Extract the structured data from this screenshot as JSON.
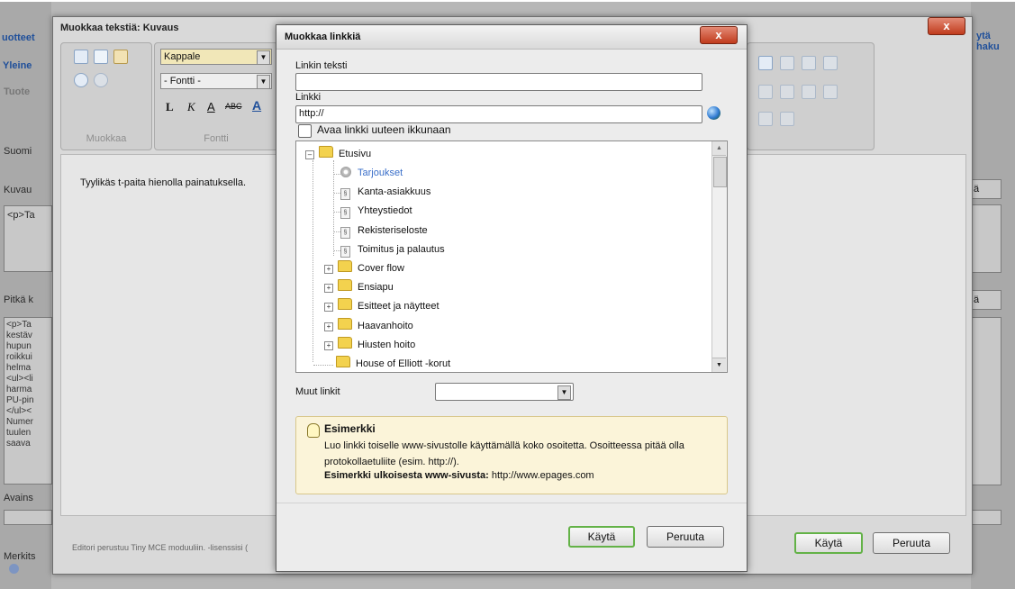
{
  "background": {
    "top_left_link": "uotteet",
    "tab_general": "Yleine",
    "tab_products": "Tuote",
    "lang": "Suomi",
    "kuvaus_label": "Kuvau",
    "kuvaus_text": "<p>Ta",
    "long_desc_label": "Pitkä k",
    "long_desc_lines": [
      "<p>Ta",
      "kestäv",
      "hupun",
      "roikkui",
      "helma",
      "<ul><li",
      "harma",
      "PU-pin",
      "</ul><",
      "Numer",
      "tuulen",
      "saava"
    ],
    "keywords_label": "Avains",
    "marks_label": "Merkits",
    "right_link": "ytä haku",
    "right_btn_1": "ä",
    "right_btn_2": "ä"
  },
  "editor": {
    "title": "Muokkaa tekstiä: Kuvaus",
    "format_select": "Kappale",
    "font_select": "- Fontti -",
    "group_edit_label": "Muokkaa",
    "group_font_label": "Fontti",
    "format_buttons": [
      "L",
      "K",
      "A",
      "ABC",
      "A"
    ],
    "content_text": "Tyylikäs t-paita hienolla painatuksella.",
    "footer_text": "Editori perustuu Tiny MCE moduuliin. -lisenssisi (",
    "apply_label": "Käytä",
    "cancel_label": "Peruuta",
    "close_label": "x"
  },
  "dialog": {
    "title": "Muokkaa linkkiä",
    "close_label": "x",
    "link_text_label": "Linkin teksti",
    "link_text_value": "",
    "link_label": "Linkki",
    "link_value": "http://",
    "new_window_label": "Avaa linkki uuteen ikkunaan",
    "tree": {
      "root": "Etusivu",
      "items": [
        {
          "label": "Tarjoukset",
          "type": "special"
        },
        {
          "label": "Kanta-asiakkuus",
          "type": "page"
        },
        {
          "label": "Yhteystiedot",
          "type": "page"
        },
        {
          "label": "Rekisteriseloste",
          "type": "page"
        },
        {
          "label": "Toimitus ja palautus",
          "type": "page"
        },
        {
          "label": "Cover flow",
          "type": "folder"
        },
        {
          "label": "Ensiapu",
          "type": "folder"
        },
        {
          "label": "Esitteet ja näytteet",
          "type": "folder"
        },
        {
          "label": "Haavanhoito",
          "type": "folder"
        },
        {
          "label": "Hiusten hoito",
          "type": "folder"
        },
        {
          "label": "House of Elliott -korut",
          "type": "folder-noexpand"
        }
      ]
    },
    "other_links_label": "Muut linkit",
    "other_links_value": "",
    "example": {
      "title": "Esimerkki",
      "body": "Luo linkki toiselle www-sivustolle käyttämällä koko osoitetta. Osoitteessa pitää olla protokollaetuliite (esim. http://).",
      "external_label": "Esimerkki ulkoisesta www-sivusta:",
      "external_value": "http://www.epages.com"
    },
    "apply_label": "Käytä",
    "cancel_label": "Peruuta"
  },
  "colors": {
    "close_red": "#c03b1d",
    "selected_link": "#3a6fc9",
    "apply_border": "#63b247",
    "note_bg": "#fbf4d9"
  }
}
